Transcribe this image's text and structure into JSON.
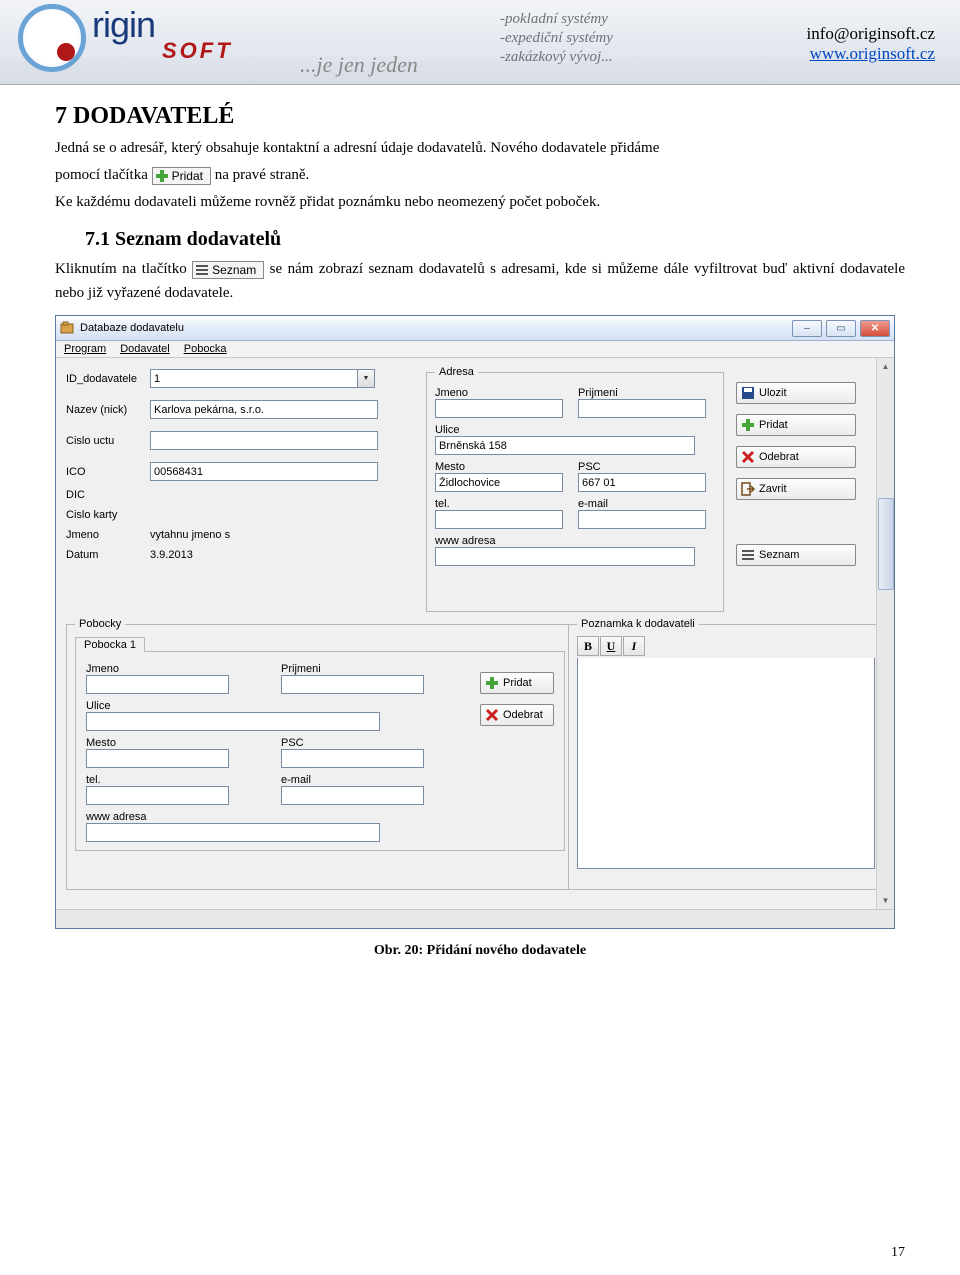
{
  "header": {
    "logo_main": "rigin",
    "logo_sub": "SOFT",
    "slogan": "...je jen jeden",
    "tags": [
      "-pokladní systémy",
      "-expediční systémy",
      "-zakázkový vývoj..."
    ],
    "email": "info@originsoft.cz",
    "web": "www.originsoft.cz"
  },
  "doc": {
    "h1": "7 DODAVATELÉ",
    "p1a": "Jedná se o adresář, který obsahuje kontaktní a adresní údaje dodavatelů. Nového dodavatele přidáme",
    "p1b": "pomocí tlačítka ",
    "p1c": " na pravé straně.",
    "p2": "Ke každému dodavateli můžeme rovněž přidat poznámku nebo neomezený počet poboček.",
    "h2": "7.1 Seznam dodavatelů",
    "p3a": "Kliknutím na tlačítko ",
    "p3b": " se nám zobrazí seznam dodavatelů s adresami, kde si můžeme dále vyfiltrovat buď aktivní dodavatele nebo již vyřazené dodavatele.",
    "caption": "Obr. 20: Přidání nového dodavatele",
    "pagenum": "17"
  },
  "inline_buttons": {
    "pridat": "Pridat",
    "seznam": "Seznam"
  },
  "window": {
    "title": "Databaze dodavatelu",
    "menu": [
      "Program",
      "Dodavatel",
      "Pobocka"
    ],
    "left": {
      "id_label": "ID_dodavatele",
      "id_value": "1",
      "nazev_label": "Nazev (nick)",
      "nazev_value": "Karlova pekárna, s.r.o.",
      "cislo_uctu_label": "Cislo uctu",
      "cislo_uctu_value": "",
      "ico_label": "ICO",
      "ico_value": "00568431",
      "dic_label": "DIC",
      "dic_value": "",
      "cislo_karty_label": "Cislo karty",
      "cislo_karty_value": "",
      "jmeno_label": "Jmeno",
      "jmeno_value": "vytahnu jmeno s",
      "datum_label": "Datum",
      "datum_value": "3.9.2013"
    },
    "adresa": {
      "legend": "Adresa",
      "jmeno_label": "Jmeno",
      "jmeno_value": "",
      "prijmeni_label": "Prijmeni",
      "prijmeni_value": "",
      "ulice_label": "Ulice",
      "ulice_value": "Brněnská 158",
      "mesto_label": "Mesto",
      "mesto_value": "Židlochovice",
      "psc_label": "PSC",
      "psc_value": "667 01",
      "tel_label": "tel.",
      "tel_value": "",
      "email_label": "e-mail",
      "email_value": "",
      "www_label": "www adresa",
      "www_value": ""
    },
    "buttons": {
      "ulozit": "Ulozit",
      "pridat": "Pridat",
      "odebrat": "Odebrat",
      "zavrit": "Zavrit",
      "seznam": "Seznam"
    },
    "pobocky": {
      "legend": "Pobocky",
      "tab": "Pobocka 1",
      "jmeno_label": "Jmeno",
      "jmeno_value": "",
      "prijmeni_label": "Prijmeni",
      "prijmeni_value": "",
      "ulice_label": "Ulice",
      "ulice_value": "",
      "mesto_label": "Mesto",
      "mesto_value": "",
      "psc_label": "PSC",
      "psc_value": "",
      "tel_label": "tel.",
      "tel_value": "",
      "email_label": "e-mail",
      "email_value": "",
      "www_label": "www adresa",
      "www_value": "",
      "btn_pridat": "Pridat",
      "btn_odebrat": "Odebrat"
    },
    "poznamka": {
      "legend": "Poznamka k dodavateli",
      "b": "B",
      "u": "U",
      "i": "I"
    }
  }
}
